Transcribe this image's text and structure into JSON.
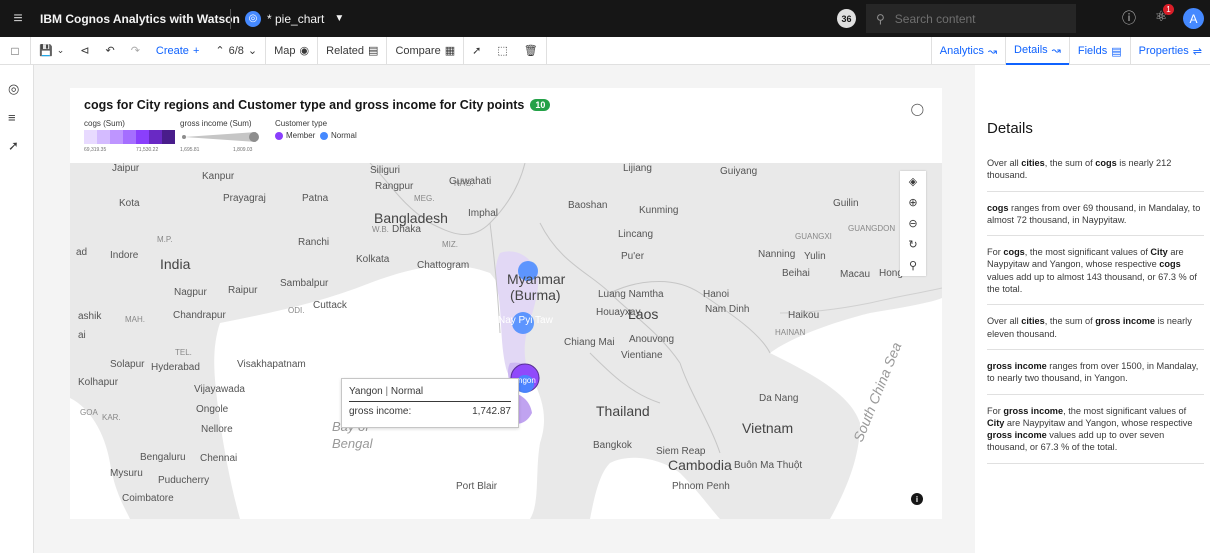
{
  "header": {
    "app_title": "IBM Cognos Analytics with Watson",
    "report_name": "* pie_chart",
    "count_badge": "36",
    "search_placeholder": "Search content",
    "notifications_count": "1",
    "avatar_initial": "A"
  },
  "toolbar": {
    "create_label": "Create",
    "page_indicator": "6/8",
    "map_label": "Map",
    "related_label": "Related",
    "compare_label": "Compare",
    "tabs": [
      "Analytics",
      "Details",
      "Fields",
      "Properties"
    ],
    "active_tab": "Details"
  },
  "visualization": {
    "title": "cogs for City regions and Customer type and gross income for City points",
    "badge": "10",
    "legend": {
      "cogs_title": "cogs (Sum)",
      "cogs_min": "69,319.35",
      "cogs_max": "71,530.22",
      "cogs_ramp": [
        "#e8daff",
        "#d4bbff",
        "#be95ff",
        "#a56eff",
        "#8a3ffc",
        "#6929c4",
        "#491d8b"
      ],
      "income_title": "gross income (Sum)",
      "income_min": "1,695.81",
      "income_max": "1,809.03",
      "customer_title": "Customer type",
      "customer_types": [
        {
          "label": "Member",
          "color": "#8a3ffc"
        },
        {
          "label": "Normal",
          "color": "#4589ff"
        }
      ]
    },
    "map_labels": {
      "countries": [
        "India",
        "Myanmar",
        "(Burma)",
        "Laos",
        "Thailand",
        "Vietnam",
        "Cambodia",
        "Bangladesh"
      ],
      "cities": [
        "Jaipur",
        "Kanpur",
        "Kota",
        "Prayagraj",
        "Patna",
        "Siliguri",
        "Rangpur",
        "Guwahati",
        "Imphal",
        "Lijiang",
        "Guiyang",
        "Guilin",
        "Baoshan",
        "Kunming",
        "Lincang",
        "Pu'er",
        "Nanning",
        "Yulin",
        "Beihai",
        "Macau",
        "Hong",
        "Indore",
        "Ranchi",
        "Kolkata",
        "Chattogram",
        "Dhaka",
        "Nagpur",
        "Raipur",
        "Sambalpur",
        "Cuttack",
        "Chandrapur",
        "Luang Namtha",
        "Hanoi",
        "Nam Dinh",
        "Haikou",
        "Houayxay",
        "Chiang Mai",
        "Anouvong",
        "Vientiane",
        "Solapur",
        "Hyderabad",
        "Visakhapatnam",
        "Kolhapur",
        "Vijayawada",
        "Ongole",
        "Nellore",
        "Bengaluru",
        "Chennai",
        "Mysuru",
        "Puducherry",
        "Coimbatore",
        "Port Blair",
        "Bangkok",
        "Siem Reap",
        "Buôn Ma Thuột",
        "Phnom Penh",
        "Da Nang",
        "ashik",
        "ad",
        "ai",
        "Nay Pyi Taw",
        "ngon"
      ],
      "regions": [
        "M.P.",
        "MAH.",
        "TEL.",
        "ODI.",
        "W.B.",
        "MIZ.",
        "NAG.",
        "MEG.",
        "KAR.",
        "GOA",
        "GUANGXI",
        "GUANGDON",
        "HAINAN"
      ],
      "seas": [
        "Bay of",
        "Bengal",
        "South China Sea"
      ]
    },
    "tooltip": {
      "city": "Yangon",
      "separator": "|",
      "customer_type": "Normal",
      "metric_label": "gross income:",
      "metric_value": "1,742.87"
    },
    "points": [
      {
        "city": "Mandalay",
        "customer_type": "Normal"
      },
      {
        "city": "Naypyitaw",
        "customer_type": "Normal"
      },
      {
        "city": "Yangon",
        "customer_type": "Member"
      },
      {
        "city": "Yangon",
        "customer_type": "Normal"
      }
    ]
  },
  "details": {
    "title": "Details",
    "items": [
      {
        "parts": [
          [
            "Over all ",
            0
          ],
          [
            "cities",
            1
          ],
          [
            ", the sum of ",
            0
          ],
          [
            "cogs",
            1
          ],
          [
            " is nearly 212 thousand.",
            0
          ]
        ]
      },
      {
        "parts": [
          [
            "cogs",
            1
          ],
          [
            " ranges from over 69 thousand, in Mandalay, to almost 72 thousand, in Naypyitaw.",
            0
          ]
        ]
      },
      {
        "parts": [
          [
            "For ",
            0
          ],
          [
            "cogs",
            1
          ],
          [
            ", the most significant values of ",
            0
          ],
          [
            "City",
            1
          ],
          [
            " are Naypyitaw and Yangon, whose respective ",
            0
          ],
          [
            "cogs",
            1
          ],
          [
            " values add up to almost 143 thousand, or 67.3 % of the total.",
            0
          ]
        ]
      },
      {
        "parts": [
          [
            "Over all ",
            0
          ],
          [
            "cities",
            1
          ],
          [
            ", the sum of ",
            0
          ],
          [
            "gross income",
            1
          ],
          [
            " is nearly eleven thousand.",
            0
          ]
        ]
      },
      {
        "parts": [
          [
            "gross income",
            1
          ],
          [
            " ranges from over 1500, in Mandalay, to nearly two thousand, in Yangon.",
            0
          ]
        ]
      },
      {
        "parts": [
          [
            "For ",
            0
          ],
          [
            "gross income",
            1
          ],
          [
            ", the most significant values of ",
            0
          ],
          [
            "City",
            1
          ],
          [
            " are Naypyitaw and Yangon, whose respective ",
            0
          ],
          [
            "gross income",
            1
          ],
          [
            " values add up to over seven thousand, or 67.3 % of the total.",
            0
          ]
        ]
      }
    ]
  }
}
